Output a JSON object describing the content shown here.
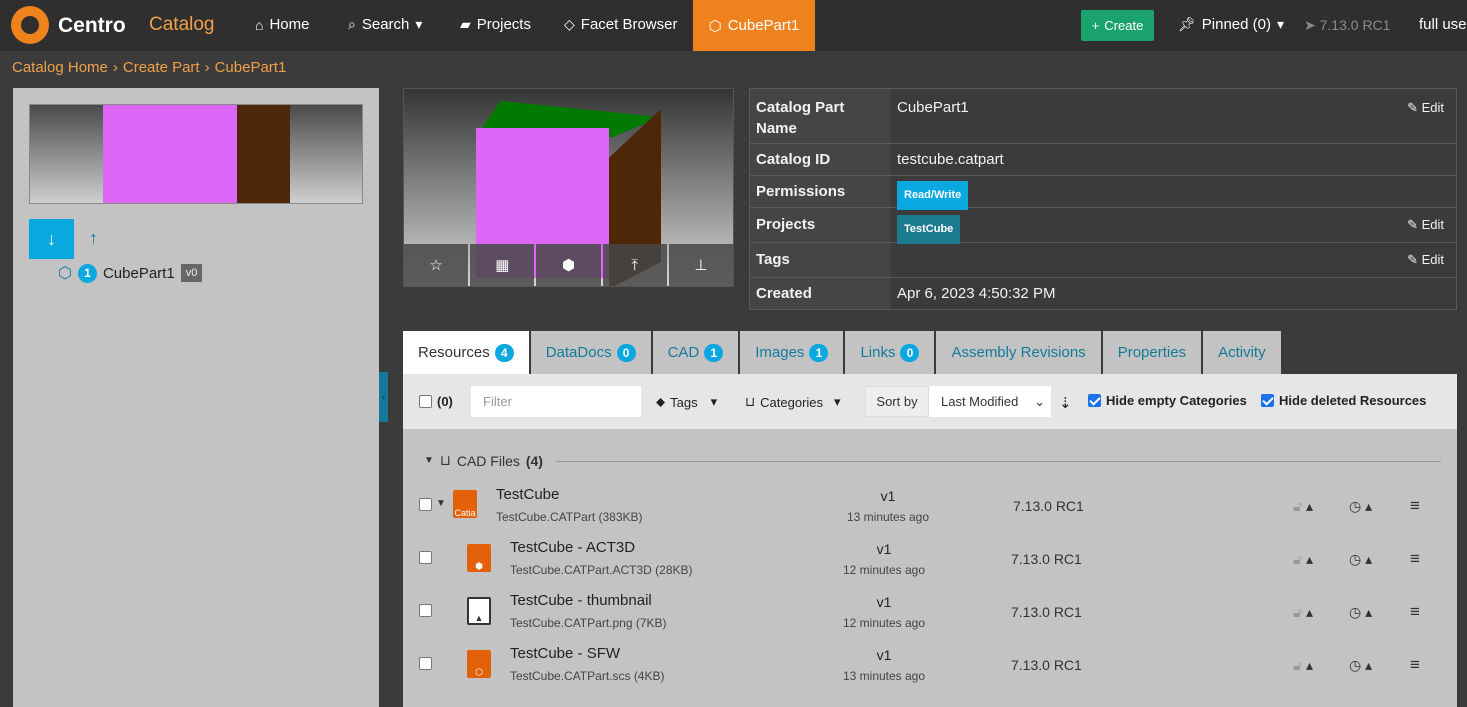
{
  "nav": {
    "brand": "Centro",
    "catalog": "Catalog",
    "home": "Home",
    "search": "Search",
    "projects": "Projects",
    "facet_browser": "Facet Browser",
    "active_tab": "CubePart1",
    "create": "Create",
    "pinned": "Pinned (0)",
    "version": "7.13.0 RC1",
    "user": "full use"
  },
  "breadcrumb": [
    "Catalog Home",
    "Create Part",
    "CubePart1"
  ],
  "tree": {
    "count": "1",
    "item": "CubePart1",
    "version": "v0"
  },
  "info": {
    "name_label": "Catalog Part Name",
    "name_value": "CubePart1",
    "id_label": "Catalog ID",
    "id_value": "testcube.catpart",
    "permissions_label": "Permissions",
    "permissions_value": "Read/Write",
    "projects_label": "Projects",
    "projects_value": "TestCube",
    "tags_label": "Tags",
    "created_label": "Created",
    "created_value": "Apr 6, 2023 4:50:32 PM",
    "edit": "Edit"
  },
  "tabs": [
    {
      "label": "Resources",
      "count": "4"
    },
    {
      "label": "DataDocs",
      "count": "0"
    },
    {
      "label": "CAD",
      "count": "1"
    },
    {
      "label": "Images",
      "count": "1"
    },
    {
      "label": "Links",
      "count": "0"
    },
    {
      "label": "Assembly Revisions",
      "count": ""
    },
    {
      "label": "Properties",
      "count": ""
    },
    {
      "label": "Activity",
      "count": ""
    }
  ],
  "toolbar": {
    "select_count": "(0)",
    "filter_placeholder": "Filter",
    "tags": "Tags",
    "categories": "Categories",
    "sort_by": "Sort by",
    "sort_value": "Last Modified",
    "hide_empty": "Hide empty Categories",
    "hide_deleted": "Hide deleted Resources"
  },
  "group": {
    "label": "CAD Files",
    "count": "(4)"
  },
  "resources": [
    {
      "name": "TestCube",
      "file": "TestCube.CATPart (383KB)",
      "version": "v1",
      "time": "13 minutes ago",
      "release": "7.13.0 RC1",
      "icon_label": "Catia"
    },
    {
      "name": "TestCube - ACT3D",
      "file": "TestCube.CATPart.ACT3D (28KB)",
      "version": "v1",
      "time": "12 minutes ago",
      "release": "7.13.0 RC1",
      "icon_label": ""
    },
    {
      "name": "TestCube - thumbnail",
      "file": "TestCube.CATPart.png (7KB)",
      "version": "v1",
      "time": "12 minutes ago",
      "release": "7.13.0 RC1",
      "icon_label": ""
    },
    {
      "name": "TestCube - SFW",
      "file": "TestCube.CATPart.scs (4KB)",
      "version": "v1",
      "time": "13 minutes ago",
      "release": "7.13.0 RC1",
      "icon_label": ""
    }
  ],
  "colors": {
    "accent": "#f0821e",
    "info_blue": "#0aa8e0",
    "create_green": "#1aa36f",
    "cube_pink": "#dd66f6",
    "cube_brown": "#4d2708",
    "cube_green": "#007a00"
  }
}
